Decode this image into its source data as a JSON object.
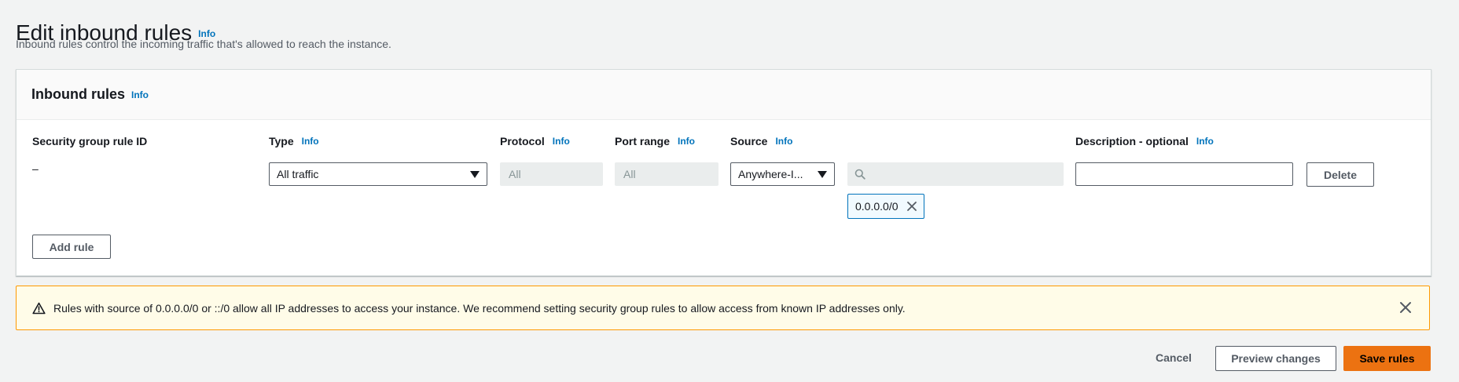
{
  "page": {
    "title": "Edit inbound rules",
    "title_info": "Info",
    "description": "Inbound rules control the incoming traffic that's allowed to reach the instance."
  },
  "panel": {
    "title": "Inbound rules",
    "title_info": "Info",
    "columns": {
      "rule_id": "Security group rule ID",
      "type": "Type",
      "protocol": "Protocol",
      "port_range": "Port range",
      "source": "Source",
      "description": "Description - optional",
      "info": "Info"
    },
    "row": {
      "rule_id": "–",
      "type_value": "All traffic",
      "protocol_value": "All",
      "port_range_value": "All",
      "source_value": "Anywhere-I...",
      "cidr_search_value": "",
      "cidr_token": "0.0.0.0/0",
      "description_value": "",
      "delete_label": "Delete"
    },
    "add_rule_label": "Add rule"
  },
  "alert": {
    "message": "Rules with source of 0.0.0.0/0 or ::/0 allow all IP addresses to access your instance. We recommend setting security group rules to allow access from known IP addresses only.",
    "icon": "warning-icon"
  },
  "footer": {
    "cancel_label": "Cancel",
    "preview_label": "Preview changes",
    "save_label": "Save rules"
  },
  "colors": {
    "link": "#0073bb",
    "primary": "#ec7211",
    "warning_border": "#ff9900",
    "warning_bg": "#fffce8"
  }
}
